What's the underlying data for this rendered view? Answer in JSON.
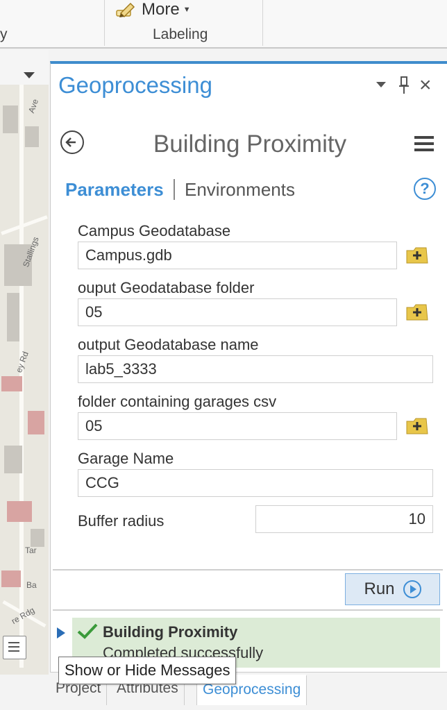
{
  "ribbon": {
    "left_group_fragment": "y",
    "more_label": "More",
    "labeling_group": "Labeling"
  },
  "map": {
    "labels": [
      "Ave",
      "Stallings",
      "ey Rd",
      "Tar",
      "Ba",
      "re Rdg"
    ]
  },
  "pane": {
    "title": "Geoprocessing",
    "tool_title": "Building Proximity",
    "tabs": {
      "parameters": "Parameters",
      "environments": "Environments"
    },
    "help_glyph": "?",
    "params": [
      {
        "label": "Campus Geodatabase",
        "value": "Campus.gdb"
      },
      {
        "label": "ouput Geodatabase folder",
        "value": "05"
      },
      {
        "label": "output Geodatabase name",
        "value": "lab5_3333"
      },
      {
        "label": "folder containing garages csv",
        "value": "05"
      },
      {
        "label": "Garage Name",
        "value": "CCG"
      },
      {
        "label": "Buffer radius",
        "value": "10"
      }
    ],
    "run_label": "Run",
    "message": {
      "title": "Building Proximity",
      "status": "Completed successfully"
    }
  },
  "tooltip": "Show or Hide Messages",
  "bottom_tabs": [
    "Project",
    "Attributes",
    "Geoprocessing"
  ],
  "colors": {
    "accent": "#3d8ed5",
    "success_bg": "#dcebd6",
    "check": "#3a9a3a",
    "browse_folder": "#e8c64a"
  },
  "icons": [
    "pencil-icon",
    "chevron-down-icon",
    "pin-icon",
    "close-icon",
    "back-icon",
    "menu-icon",
    "help-icon",
    "browse-folder-icon",
    "play-icon",
    "expand-arrow-icon",
    "checkmark-icon",
    "document-icon"
  ]
}
